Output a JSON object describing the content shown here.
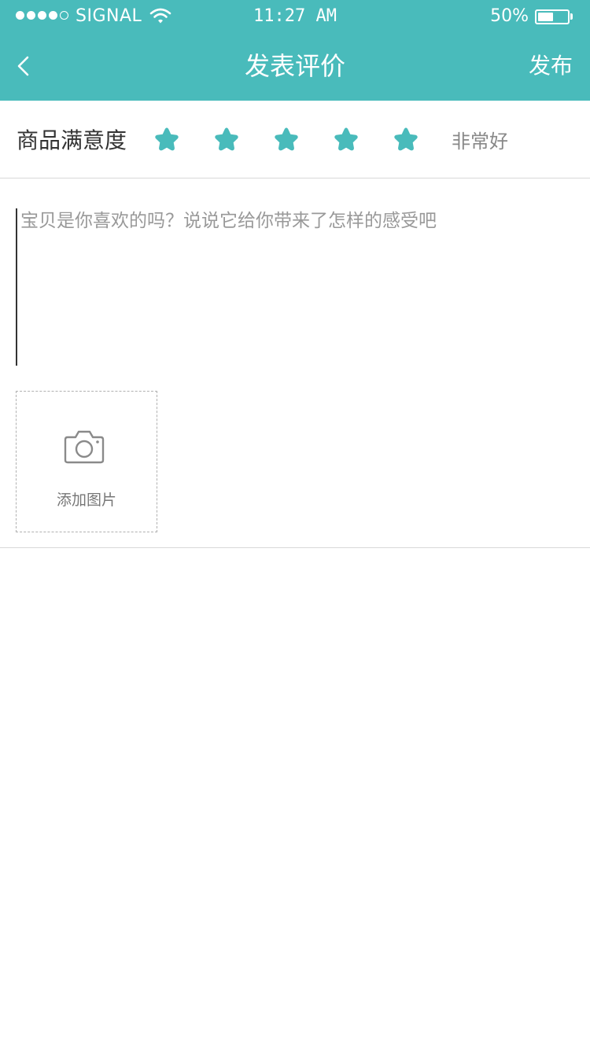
{
  "status_bar": {
    "carrier": "SIGNAL",
    "time": "11:27 AM",
    "battery": "50%",
    "battery_level": 0.5
  },
  "nav": {
    "title": "发表评价",
    "publish_label": "发布"
  },
  "rating": {
    "label": "商品满意度",
    "value": 5,
    "max": 5,
    "text": "非常好"
  },
  "review": {
    "placeholder": "宝贝是你喜欢的吗？说说它给你带来了怎样的感受吧",
    "value": ""
  },
  "photo": {
    "add_label": "添加图片"
  },
  "colors": {
    "accent": "#49BBBB",
    "divider": "#D8D8D8"
  },
  "icons": {
    "back": "chevron-left-icon",
    "star": "star-icon",
    "camera": "camera-icon",
    "wifi": "wifi-icon",
    "battery": "battery-icon"
  }
}
